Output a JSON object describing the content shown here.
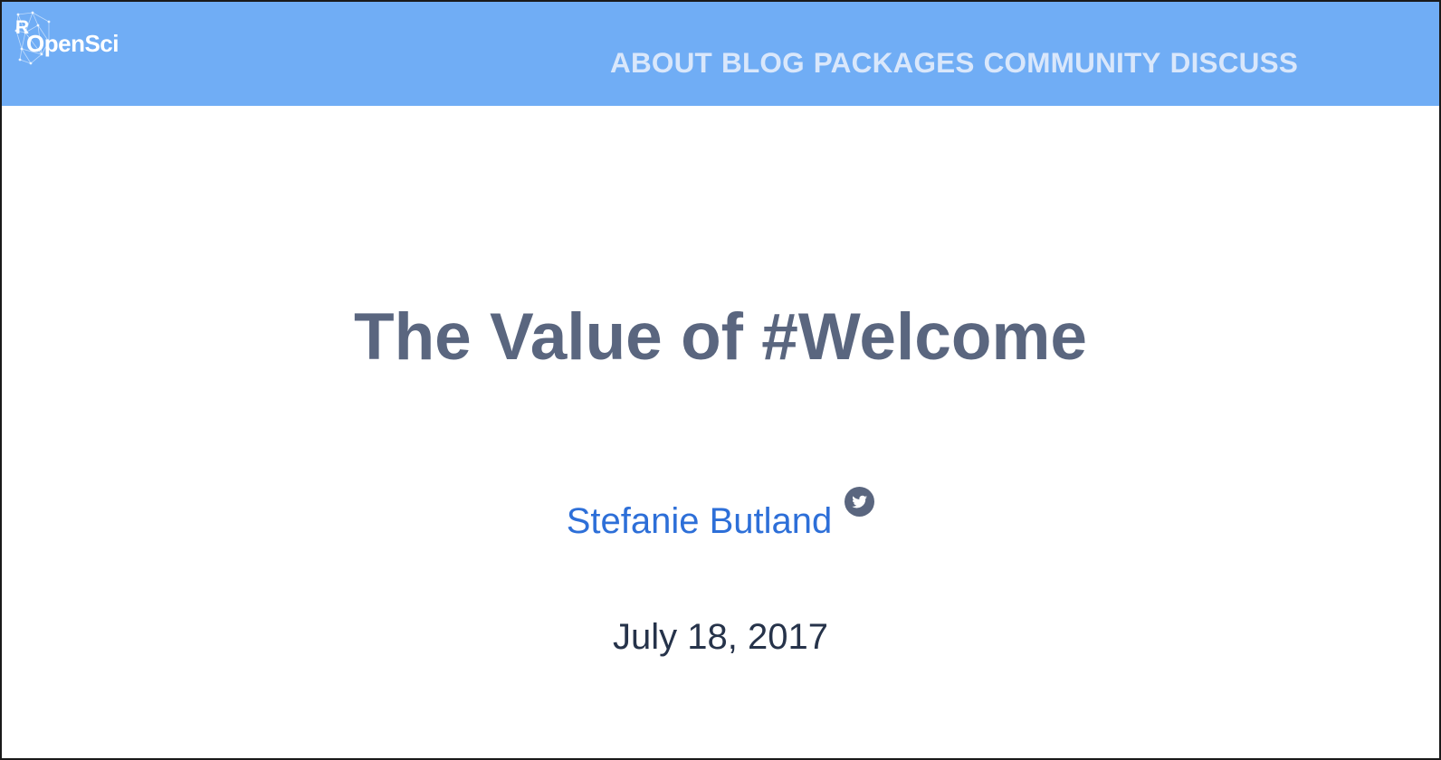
{
  "colors": {
    "navbar_background": "#70adf5",
    "nav_link": "#d9e7fb",
    "title": "#5a667f",
    "author_link": "#2d6fd8",
    "date_text": "#26334a",
    "icon": "#5a667f"
  },
  "header": {
    "logo": {
      "r_letter": "R",
      "wordmark": "OpenSci"
    },
    "nav": [
      {
        "label": "ABOUT"
      },
      {
        "label": "BLOG"
      },
      {
        "label": "PACKAGES"
      },
      {
        "label": "COMMUNITY"
      },
      {
        "label": "DISCUSS"
      }
    ]
  },
  "post": {
    "title": "The Value of #Welcome",
    "author": "Stefanie Butland",
    "author_icon": "twitter-icon",
    "date": "July 18, 2017"
  }
}
